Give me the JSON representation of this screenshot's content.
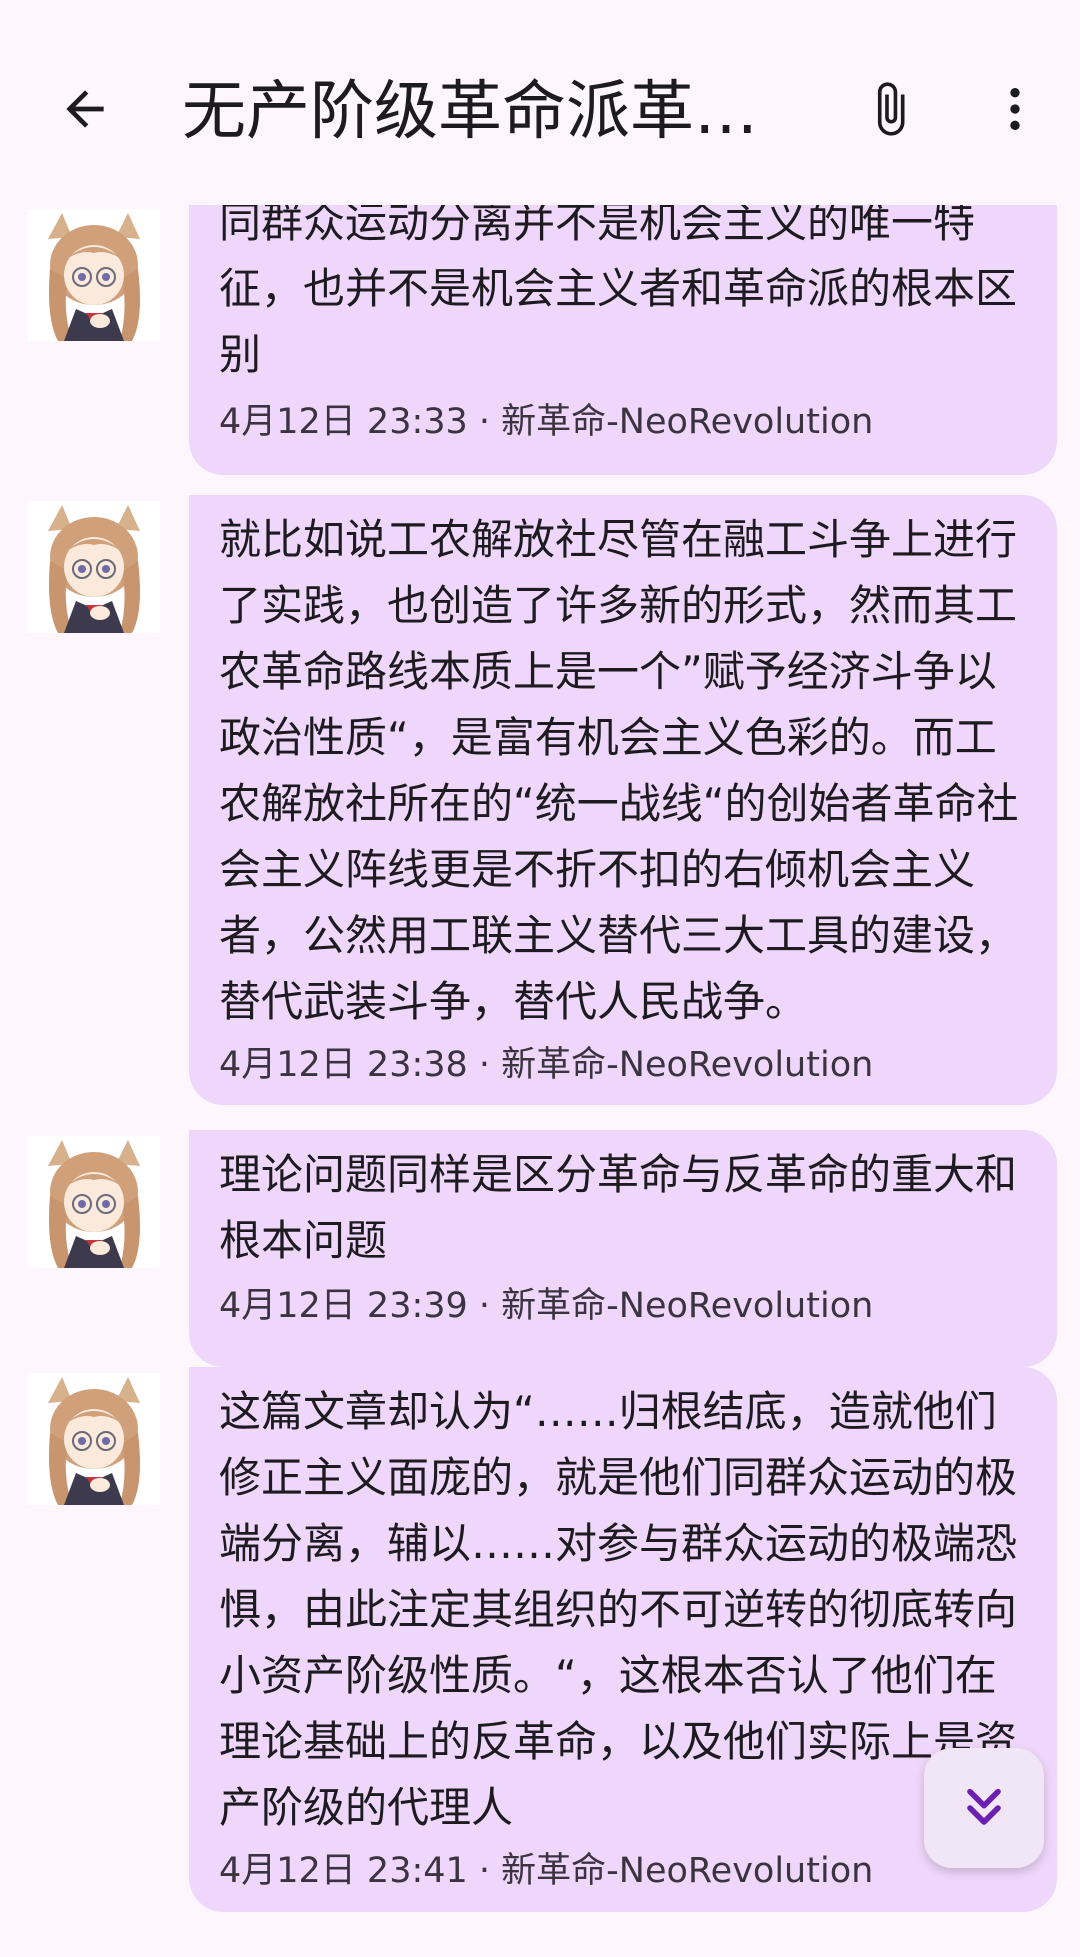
{
  "header": {
    "title": "无产阶级革命派革…",
    "back_icon": "arrow-back-icon",
    "attach_icon": "paperclip-icon",
    "more_icon": "more-vertical-icon"
  },
  "messages": [
    {
      "text": "同群众运动分离并不是机会主义的唯一特征，也并不是机会主义者和革命派的根本区别",
      "meta": "4月12日 23:33 · 新革命-NeoRevolution"
    },
    {
      "text": "就比如说工农解放社尽管在融工斗争上进行了实践，也创造了许多新的形式，然而其工农革命路线本质上是一个”赋予经济斗争以政治性质“，是富有机会主义色彩的。而工农解放社所在的“统一战线“的创始者革命社会主义阵线更是不折不扣的右倾机会主义者，公然用工联主义替代三大工具的建设，替代武装斗争，替代人民战争。",
      "meta": "4月12日 23:38 · 新革命-NeoRevolution"
    },
    {
      "text": "理论问题同样是区分革命与反革命的重大和根本问题",
      "meta": "4月12日 23:39 · 新革命-NeoRevolution"
    },
    {
      "text": "这篇文章却认为“……归根结底，造就他们修正主义面庞的，就是他们同群众运动的极端分离，辅以……对参与群众运动的极端恐惧，由此注定其组织的不可逆转的彻底转向小资产阶级性质。“，这根本否认了他们在理论基础上的反革命，以及他们实际上是资产阶级的代理人",
      "meta": "4月12日 23:41 · 新革命-NeoRevolution"
    }
  ],
  "fab": {
    "icon": "double-chevron-down-icon"
  },
  "colors": {
    "background": "#fdf7fd",
    "bubble": "#efd7fb",
    "text": "#1d1b20",
    "accent": "#6b1fb1"
  }
}
